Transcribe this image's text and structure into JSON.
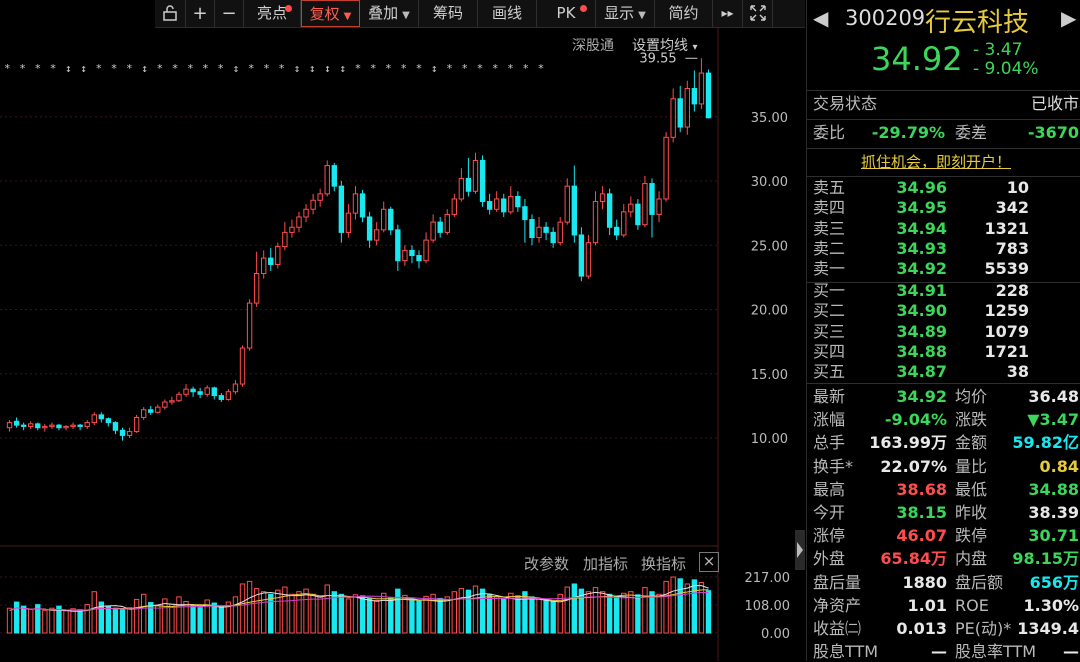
{
  "toolbar": {
    "lock_icon": "lock-icon",
    "plus": "+",
    "minus": "−",
    "items": [
      {
        "label": "亮点",
        "dot": true,
        "caret": false
      },
      {
        "label": "复权",
        "dot": false,
        "caret": true,
        "active": true
      },
      {
        "label": "叠加",
        "dot": false,
        "caret": true
      },
      {
        "label": "筹码",
        "dot": false,
        "caret": false
      },
      {
        "label": "画线",
        "dot": false,
        "caret": false
      },
      {
        "label": "PK",
        "dot": true,
        "caret": false
      },
      {
        "label": "显示",
        "dot": false,
        "caret": true
      },
      {
        "label": "简约",
        "dot": false,
        "caret": false
      }
    ],
    "more": "▸▸",
    "expand_icon": "expand-icon"
  },
  "chart": {
    "top_links": [
      "深股通",
      "设置均线"
    ],
    "max_label": "39.55",
    "price_ticks": [
      "35.00",
      "30.00",
      "25.00",
      "20.00",
      "15.00",
      "10.00"
    ],
    "volume_ticks": [
      "217.00",
      "108.00",
      "0.00"
    ],
    "volume_menu": [
      "改参数",
      "加指标",
      "换指标"
    ],
    "close_icon": "×"
  },
  "chart_data": {
    "type": "candlestick",
    "y_ticks": [
      10,
      15,
      20,
      25,
      30,
      35
    ],
    "max_marker": 39.55,
    "volume_ticks": [
      0,
      108,
      217
    ],
    "candles": [
      [
        10.8,
        11.2,
        10.5,
        11.4
      ],
      [
        11.3,
        11.0,
        10.8,
        11.6
      ],
      [
        11.0,
        10.9,
        10.6,
        11.2
      ],
      [
        10.9,
        11.1,
        10.7,
        11.3
      ],
      [
        11.1,
        10.8,
        10.6,
        11.2
      ],
      [
        10.8,
        10.9,
        10.5,
        11.1
      ],
      [
        10.9,
        11.0,
        10.7,
        11.2
      ],
      [
        11.0,
        10.8,
        10.6,
        11.1
      ],
      [
        10.8,
        10.9,
        10.6,
        11.0
      ],
      [
        10.9,
        11.0,
        10.7,
        11.2
      ],
      [
        11.0,
        10.9,
        10.6,
        11.1
      ],
      [
        10.9,
        11.2,
        10.7,
        11.4
      ],
      [
        11.2,
        11.8,
        11.0,
        12.0
      ],
      [
        11.8,
        11.5,
        11.2,
        12.0
      ],
      [
        11.5,
        11.2,
        10.9,
        11.6
      ],
      [
        11.2,
        10.6,
        10.3,
        11.3
      ],
      [
        10.6,
        10.2,
        9.8,
        10.8
      ],
      [
        10.2,
        10.5,
        10.0,
        10.8
      ],
      [
        10.5,
        11.6,
        10.4,
        11.8
      ],
      [
        11.6,
        12.2,
        11.4,
        12.4
      ],
      [
        12.2,
        12.0,
        11.8,
        12.5
      ],
      [
        12.0,
        12.4,
        11.9,
        12.6
      ],
      [
        12.4,
        12.8,
        12.2,
        13.0
      ],
      [
        12.8,
        12.9,
        12.6,
        13.2
      ],
      [
        12.9,
        13.4,
        12.8,
        13.6
      ],
      [
        13.4,
        13.8,
        13.2,
        14.2
      ],
      [
        13.8,
        13.6,
        13.2,
        14.0
      ],
      [
        13.6,
        13.4,
        13.1,
        13.9
      ],
      [
        13.4,
        13.9,
        13.2,
        14.1
      ],
      [
        13.9,
        13.3,
        13.0,
        14.0
      ],
      [
        13.3,
        13.0,
        12.8,
        13.5
      ],
      [
        13.0,
        13.6,
        12.9,
        13.8
      ],
      [
        13.6,
        14.2,
        13.4,
        14.5
      ],
      [
        14.2,
        17.0,
        14.0,
        17.2
      ],
      [
        17.0,
        20.5,
        16.8,
        20.8
      ],
      [
        20.5,
        22.8,
        20.2,
        24.5
      ],
      [
        22.8,
        24.0,
        22.4,
        24.6
      ],
      [
        24.0,
        23.5,
        23.0,
        24.8
      ],
      [
        23.5,
        24.9,
        23.2,
        25.2
      ],
      [
        24.9,
        26.0,
        24.6,
        26.8
      ],
      [
        26.0,
        26.4,
        25.6,
        27.0
      ],
      [
        26.4,
        27.2,
        26.0,
        27.6
      ],
      [
        27.2,
        27.8,
        26.8,
        28.2
      ],
      [
        27.8,
        28.5,
        27.4,
        29.0
      ],
      [
        28.5,
        29.0,
        28.0,
        29.4
      ],
      [
        29.0,
        31.2,
        28.8,
        31.6
      ],
      [
        31.2,
        29.6,
        29.2,
        31.4
      ],
      [
        29.6,
        26.0,
        25.2,
        30.0
      ],
      [
        26.0,
        27.5,
        25.6,
        28.2
      ],
      [
        27.5,
        29.0,
        27.0,
        29.6
      ],
      [
        29.0,
        27.2,
        26.8,
        29.3
      ],
      [
        27.2,
        25.4,
        24.8,
        27.6
      ],
      [
        25.4,
        26.2,
        25.0,
        26.8
      ],
      [
        26.2,
        27.8,
        26.0,
        28.4
      ],
      [
        27.8,
        26.2,
        25.8,
        28.0
      ],
      [
        26.2,
        23.8,
        23.0,
        26.6
      ],
      [
        23.8,
        24.6,
        23.4,
        25.0
      ],
      [
        24.6,
        24.2,
        23.6,
        25.0
      ],
      [
        24.2,
        23.8,
        23.2,
        24.6
      ],
      [
        23.8,
        25.4,
        23.6,
        26.0
      ],
      [
        25.4,
        26.8,
        25.2,
        27.4
      ],
      [
        26.8,
        26.0,
        25.6,
        27.2
      ],
      [
        26.0,
        27.4,
        25.8,
        27.8
      ],
      [
        27.4,
        28.6,
        27.2,
        29.0
      ],
      [
        28.6,
        30.2,
        28.4,
        31.0
      ],
      [
        30.2,
        29.2,
        28.8,
        31.8
      ],
      [
        29.2,
        31.6,
        29.0,
        32.2
      ],
      [
        31.6,
        28.4,
        28.0,
        32.0
      ],
      [
        28.4,
        27.8,
        27.4,
        29.0
      ],
      [
        27.8,
        28.6,
        27.6,
        29.2
      ],
      [
        28.6,
        27.6,
        27.2,
        29.0
      ],
      [
        27.6,
        28.8,
        27.4,
        29.6
      ],
      [
        28.8,
        28.0,
        27.6,
        29.2
      ],
      [
        28.0,
        27.0,
        25.2,
        28.6
      ],
      [
        27.0,
        25.6,
        25.0,
        27.4
      ],
      [
        25.6,
        26.4,
        25.2,
        27.2
      ],
      [
        26.4,
        26.0,
        25.4,
        26.8
      ],
      [
        26.0,
        25.2,
        24.8,
        26.4
      ],
      [
        25.2,
        26.8,
        25.0,
        27.2
      ],
      [
        26.8,
        29.6,
        26.6,
        30.2
      ],
      [
        29.6,
        25.8,
        25.2,
        31.2
      ],
      [
        25.8,
        22.6,
        22.2,
        26.4
      ],
      [
        22.6,
        25.2,
        22.4,
        25.8
      ],
      [
        25.2,
        28.4,
        25.0,
        29.2
      ],
      [
        28.4,
        29.0,
        27.8,
        29.6
      ],
      [
        29.0,
        26.4,
        25.8,
        29.4
      ],
      [
        26.4,
        25.8,
        25.4,
        27.0
      ],
      [
        25.8,
        27.6,
        25.6,
        28.2
      ],
      [
        27.6,
        28.2,
        27.2,
        28.8
      ],
      [
        28.2,
        26.6,
        26.2,
        28.6
      ],
      [
        26.6,
        29.8,
        26.4,
        30.4
      ],
      [
        29.8,
        27.4,
        25.6,
        30.2
      ],
      [
        27.4,
        28.6,
        26.8,
        29.2
      ],
      [
        28.6,
        33.4,
        28.4,
        33.8
      ],
      [
        33.4,
        36.4,
        33.0,
        37.2
      ],
      [
        36.4,
        34.2,
        33.8,
        37.4
      ],
      [
        34.2,
        37.2,
        33.6,
        37.8
      ],
      [
        37.2,
        36.0,
        35.4,
        38.6
      ],
      [
        36.0,
        38.4,
        35.6,
        39.55
      ],
      [
        38.4,
        34.92,
        34.88,
        38.68
      ]
    ],
    "volumes": [
      96,
      120,
      104,
      92,
      110,
      88,
      96,
      104,
      86,
      94,
      90,
      110,
      160,
      120,
      104,
      96,
      90,
      98,
      130,
      150,
      118,
      106,
      132,
      112,
      140,
      122,
      108,
      98,
      128,
      116,
      104,
      120,
      140,
      190,
      200,
      172,
      160,
      150,
      166,
      178,
      150,
      160,
      170,
      150,
      140,
      186,
      160,
      150,
      132,
      148,
      144,
      134,
      126,
      154,
      138,
      170,
      146,
      130,
      126,
      142,
      150,
      134,
      140,
      160,
      172,
      166,
      182,
      170,
      150,
      140,
      134,
      154,
      144,
      160,
      140,
      132,
      128,
      120,
      150,
      178,
      190,
      170,
      160,
      176,
      160,
      150,
      140,
      154,
      160,
      148,
      176,
      160,
      150,
      200,
      217,
      210,
      190,
      206,
      196,
      164
    ]
  },
  "panel": {
    "code": "300209",
    "name": "行云科技",
    "price": "34.92",
    "change": "- 3.47",
    "change_pct": "- 9.04%",
    "status_label": "交易状态",
    "status_value": "已收市",
    "weibi_label": "委比",
    "weibi_value": "-29.79%",
    "weicha_label": "委差",
    "weicha_value": "-3670",
    "ad_text": "抓住机会，即刻开户！",
    "asks": [
      {
        "label": "卖五",
        "price": "34.96",
        "vol": "10"
      },
      {
        "label": "卖四",
        "price": "34.95",
        "vol": "342"
      },
      {
        "label": "卖三",
        "price": "34.94",
        "vol": "1321"
      },
      {
        "label": "卖二",
        "price": "34.93",
        "vol": "783"
      },
      {
        "label": "卖一",
        "price": "34.92",
        "vol": "5539"
      }
    ],
    "bids": [
      {
        "label": "买一",
        "price": "34.91",
        "vol": "228"
      },
      {
        "label": "买二",
        "price": "34.90",
        "vol": "1259"
      },
      {
        "label": "买三",
        "price": "34.89",
        "vol": "1079"
      },
      {
        "label": "买四",
        "price": "34.88",
        "vol": "1721"
      },
      {
        "label": "买五",
        "price": "34.87",
        "vol": "38"
      }
    ],
    "stats": [
      {
        "l1": "最新",
        "v1": "34.92",
        "c1": "green",
        "l2": "均价",
        "v2": "36.48",
        "c2": "white"
      },
      {
        "l1": "涨幅",
        "v1": "-9.04%",
        "c1": "green",
        "l2": "涨跌",
        "v2": "▼3.47",
        "c2": "green"
      },
      {
        "l1": "总手",
        "v1": "163.99万",
        "c1": "white",
        "l2": "金额",
        "v2": "59.82亿",
        "c2": "cyan"
      },
      {
        "l1": "换手*",
        "v1": "22.07%",
        "c1": "white",
        "l2": "量比",
        "v2": "0.84",
        "c2": "yellow"
      },
      {
        "l1": "最高",
        "v1": "38.68",
        "c1": "red",
        "l2": "最低",
        "v2": "34.88",
        "c2": "green"
      },
      {
        "l1": "今开",
        "v1": "38.15",
        "c1": "green",
        "l2": "昨收",
        "v2": "38.39",
        "c2": "white"
      },
      {
        "l1": "涨停",
        "v1": "46.07",
        "c1": "red",
        "l2": "跌停",
        "v2": "30.71",
        "c2": "green"
      },
      {
        "l1": "外盘",
        "v1": "65.84万",
        "c1": "red",
        "l2": "内盘",
        "v2": "98.15万",
        "c2": "green"
      },
      {
        "l1": "盘后量",
        "v1": "1880",
        "c1": "white",
        "l2": "盘后额",
        "v2": "656万",
        "c2": "cyan"
      },
      {
        "l1": "净资产",
        "v1": "1.01",
        "c1": "white",
        "l2": "ROE",
        "v2": "1.30%",
        "c2": "white"
      },
      {
        "l1": "收益㈡",
        "v1": "0.013",
        "c1": "white",
        "l2": "PE(动)*",
        "v2": "1349.4",
        "c2": "white"
      },
      {
        "l1": "股息TTM",
        "v1": "—",
        "c1": "white",
        "l2": "股息率TTM",
        "v2": "—",
        "c2": "white"
      }
    ]
  },
  "colors": {
    "up": "#ff4d4d",
    "down": "#18e8f0",
    "green": "#3bd65a",
    "grid": "#3a1414",
    "ma5": "#e8e0e0",
    "ma10": "#e6cc3c",
    "ma20": "#d040d0"
  }
}
